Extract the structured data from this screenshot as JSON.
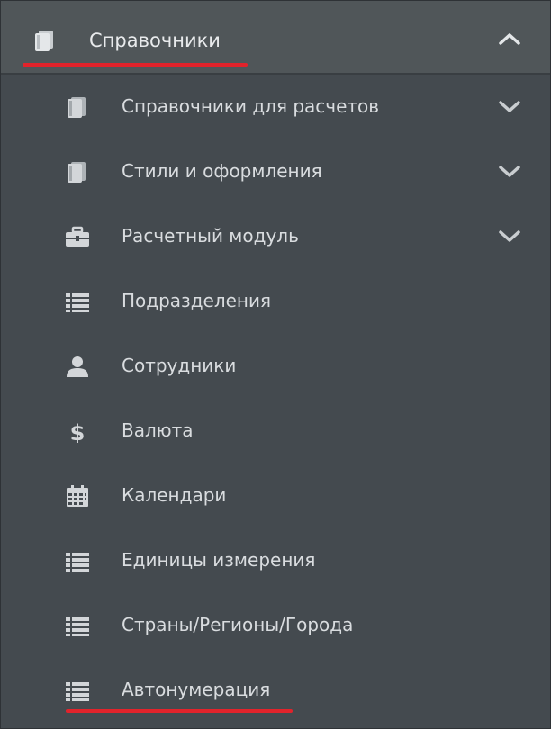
{
  "header": {
    "title": "Справочники",
    "icon": "book-icon",
    "toggle_icon": "chevron-up-icon",
    "accent": "#e2232b"
  },
  "menu": {
    "items": [
      {
        "label": "Справочники для расчетов",
        "icon": "book-icon",
        "expandable": true
      },
      {
        "label": "Стили и оформления",
        "icon": "book-icon",
        "expandable": true
      },
      {
        "label": "Расчетный модуль",
        "icon": "briefcase-icon",
        "expandable": true
      },
      {
        "label": "Подразделения",
        "icon": "list-icon",
        "expandable": false
      },
      {
        "label": "Сотрудники",
        "icon": "user-icon",
        "expandable": false
      },
      {
        "label": "Валюта",
        "icon": "dollar-icon",
        "expandable": false
      },
      {
        "label": "Календари",
        "icon": "calendar-icon",
        "expandable": false
      },
      {
        "label": "Единицы измерения",
        "icon": "list-icon",
        "expandable": false
      },
      {
        "label": "Страны/Регионы/Города",
        "icon": "list-icon",
        "expandable": false
      },
      {
        "label": "Автонумерация",
        "icon": "list-icon",
        "expandable": false,
        "highlighted": true
      }
    ]
  }
}
